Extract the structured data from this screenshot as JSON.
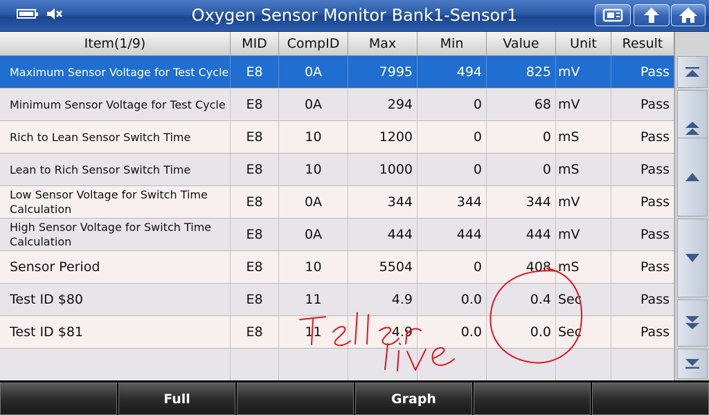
{
  "header": {
    "title": "Oxygen Sensor Monitor Bank1-Sensor1",
    "icons": [
      "battery-icon",
      "mute-icon",
      "print-icon",
      "back-icon",
      "home-icon"
    ]
  },
  "table": {
    "columns": [
      "Item(1/9)",
      "MID",
      "CompID",
      "Max",
      "Min",
      "Value",
      "Unit",
      "Result"
    ],
    "rows": [
      {
        "item": "Maximum Sensor Voltage for Test Cycle",
        "mid": "E8",
        "comp": "0A",
        "max": "7995",
        "min": "494",
        "value": "825",
        "unit": "mV",
        "result": "Pass"
      },
      {
        "item": "Minimum Sensor Voltage for Test Cycle",
        "mid": "E8",
        "comp": "0A",
        "max": "294",
        "min": "0",
        "value": "68",
        "unit": "mV",
        "result": "Pass"
      },
      {
        "item": "Rich to Lean Sensor Switch Time",
        "mid": "E8",
        "comp": "10",
        "max": "1200",
        "min": "0",
        "value": "0",
        "unit": "mS",
        "result": "Pass"
      },
      {
        "item": "Lean to Rich Sensor Switch Time",
        "mid": "E8",
        "comp": "10",
        "max": "1000",
        "min": "0",
        "value": "0",
        "unit": "mS",
        "result": "Pass"
      },
      {
        "item": "Low Sensor Voltage for Switch Time Calculation",
        "mid": "E8",
        "comp": "0A",
        "max": "344",
        "min": "344",
        "value": "344",
        "unit": "mV",
        "result": "Pass"
      },
      {
        "item": "High Sensor Voltage for Switch Time Calculation",
        "mid": "E8",
        "comp": "0A",
        "max": "444",
        "min": "444",
        "value": "444",
        "unit": "mV",
        "result": "Pass"
      },
      {
        "item": "Sensor Period",
        "mid": "E8",
        "comp": "10",
        "max": "5504",
        "min": "0",
        "value": "408",
        "unit": "mS",
        "result": "Pass"
      },
      {
        "item": "Test ID $80",
        "mid": "E8",
        "comp": "11",
        "max": "4.9",
        "min": "0.0",
        "value": "0.4",
        "unit": "Sec",
        "result": "Pass"
      },
      {
        "item": "Test ID $81",
        "mid": "E8",
        "comp": "11",
        "max": "4.9",
        "min": "0.0",
        "value": "0.0",
        "unit": "Sec",
        "result": "Pass"
      },
      {
        "item": "",
        "mid": "",
        "comp": "",
        "max": "",
        "min": "",
        "value": "",
        "unit": "",
        "result": ""
      }
    ]
  },
  "scrollbar": {
    "buttons": [
      "scroll-top-icon",
      "page-up-icon",
      "line-up-icon",
      "line-down-icon",
      "page-down-icon",
      "scroll-bottom-icon"
    ]
  },
  "footer": {
    "buttons": [
      "",
      "Full",
      "",
      "Graph",
      "",
      ""
    ]
  },
  "annotation": {
    "handwriting": "Feller live",
    "ink_color": "#e0161c"
  }
}
